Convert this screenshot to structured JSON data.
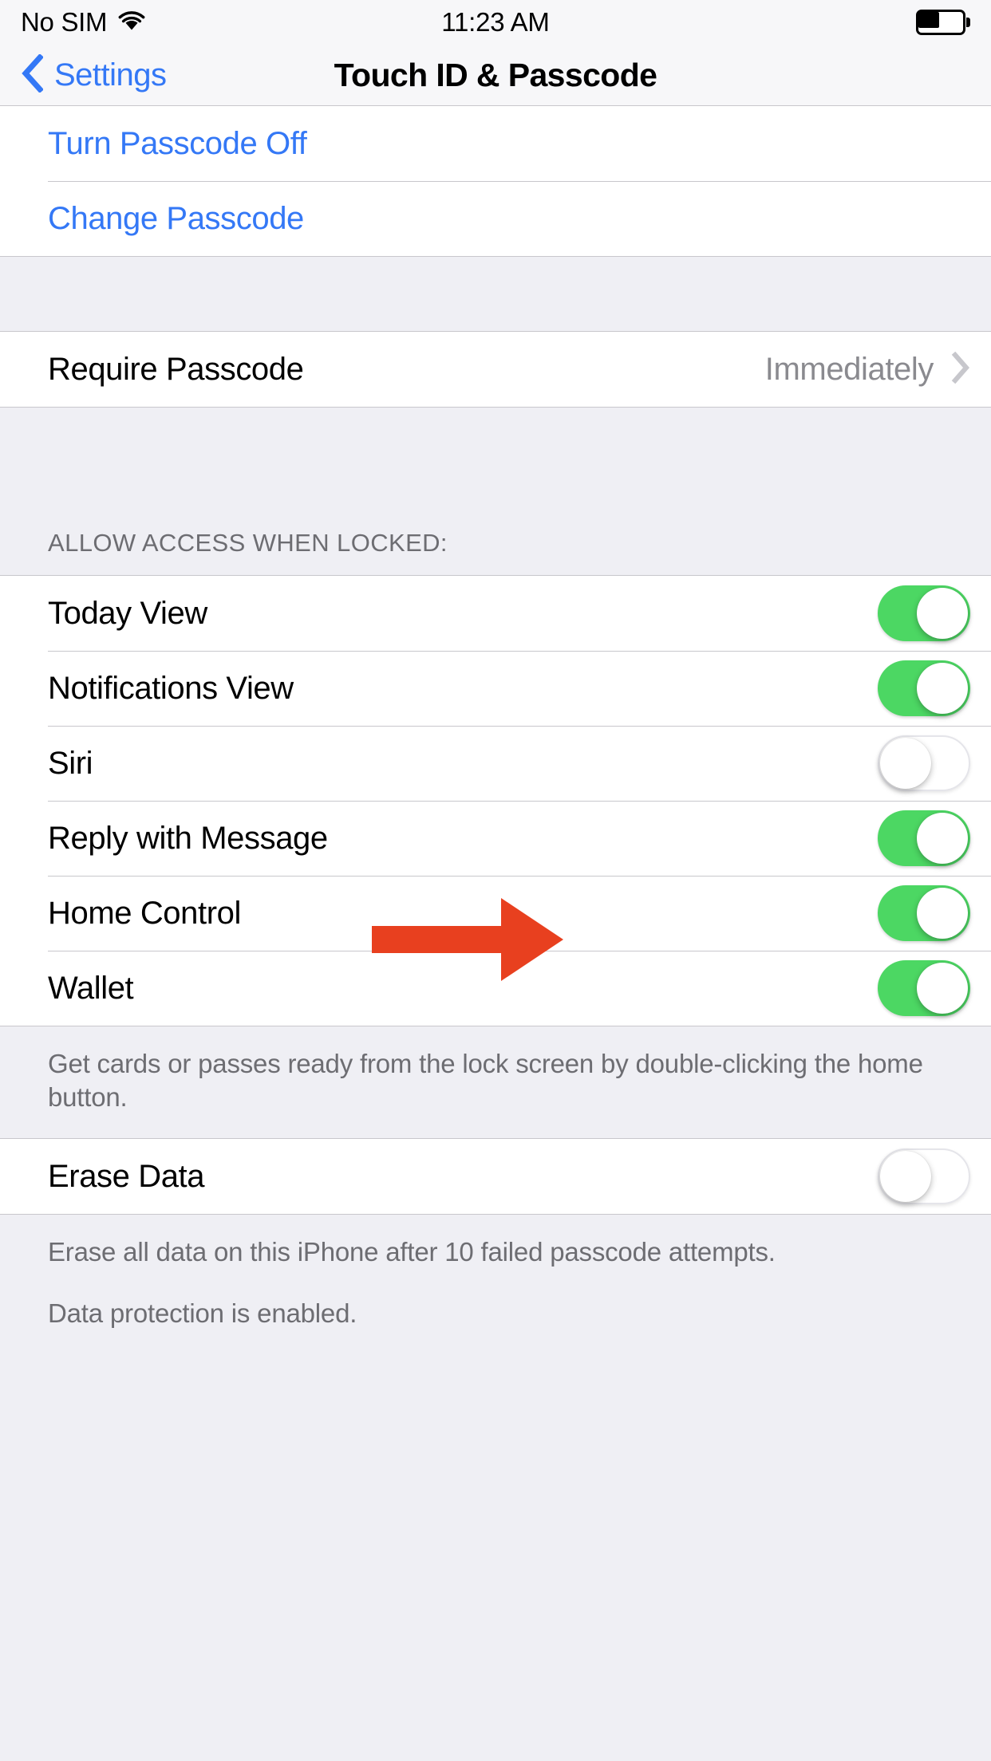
{
  "status_bar": {
    "carrier": "No SIM",
    "wifi_icon": "wifi-icon",
    "time": "11:23 AM",
    "battery_icon": "battery-icon",
    "battery_level_percent": 48
  },
  "nav_bar": {
    "back_icon": "chevron-left-icon",
    "back_label": "Settings",
    "title": "Touch ID & Passcode"
  },
  "passcode_actions": [
    {
      "label": "Turn Passcode Off",
      "style": "link"
    },
    {
      "label": "Change Passcode",
      "style": "link"
    }
  ],
  "require_passcode": {
    "label": "Require Passcode",
    "value": "Immediately",
    "disclosure_icon": "chevron-right-icon"
  },
  "allow_access": {
    "header": "ALLOW ACCESS WHEN LOCKED:",
    "items": [
      {
        "label": "Today View",
        "enabled": true
      },
      {
        "label": "Notifications View",
        "enabled": true
      },
      {
        "label": "Siri",
        "enabled": false
      },
      {
        "label": "Reply with Message",
        "enabled": true
      },
      {
        "label": "Home Control",
        "enabled": true
      },
      {
        "label": "Wallet",
        "enabled": true
      }
    ],
    "footer": "Get cards or passes ready from the lock screen by double-clicking the home button."
  },
  "erase_data": {
    "label": "Erase Data",
    "enabled": false,
    "footer_lines": [
      "Erase all data on this iPhone after 10 failed passcode attempts.",
      "Data protection is enabled."
    ]
  },
  "annotation": {
    "arrow_color": "#E8401F",
    "points_to": "Siri"
  },
  "colors": {
    "tint_blue": "#3478F6",
    "switch_on_green": "#4CD763",
    "group_bg": "#EFEFF4",
    "separator": "#C8C7CC",
    "secondary_text": "#8A8A8F",
    "header_text": "#6D6D72"
  }
}
